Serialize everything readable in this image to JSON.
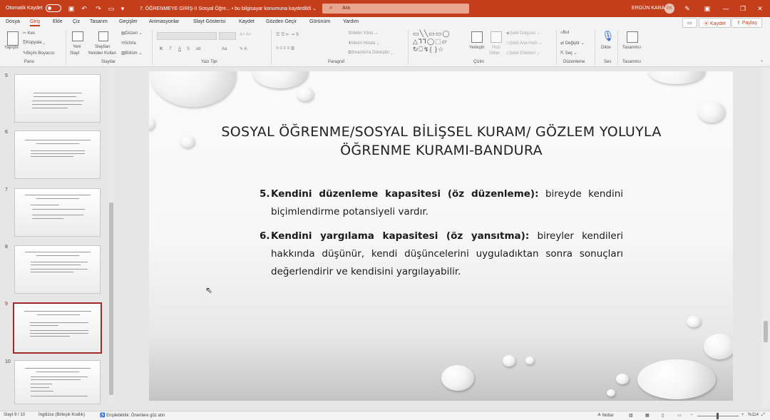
{
  "titlebar": {
    "autosave_label": "Otomatik Kaydet",
    "document_title": "7. ÖĞRENMEYE GİRİŞ-II Sosyal Öğre... • bu bilgisayar konumuna kaydedildi ⌄",
    "search_placeholder": "Ara",
    "user_name": "ERGÜN KARA",
    "user_initials": "EK"
  },
  "tabs": [
    "Dosya",
    "Giriş",
    "Ekle",
    "Çiz",
    "Tasarım",
    "Geçişler",
    "Animasyonlar",
    "Slayt Gösterisi",
    "Kaydet",
    "Gözden Geçir",
    "Görünüm",
    "Yardım"
  ],
  "tab_actions": {
    "record_label": "Kaydet",
    "share_label": "Paylaş"
  },
  "ribbon": {
    "clipboard": {
      "paste": "Yapıştır",
      "cut": "Kes",
      "copy": "Kopyala",
      "format_painter": "Biçim Boyacısı",
      "group": "Pano"
    },
    "slides": {
      "new_slide_line1": "Yeni",
      "new_slide_line2": "Slayt",
      "reuse_line1": "Slaytları",
      "reuse_line2": "Yeniden Kullan",
      "layout": "Düzen",
      "reset": "Sıfırla",
      "section": "Bölüm",
      "group": "Slaytlar"
    },
    "font": {
      "bold": "K",
      "italic": "T",
      "underline": "A",
      "strike": "S",
      "spacing": "ab",
      "case": "Aa",
      "group": "Yazı Tipi"
    },
    "paragraph": {
      "text_direction": "Metin Yönü",
      "align_text": "Metni Hizala",
      "smartart": "SmartArt'a Dönüştür",
      "group": "Paragraf"
    },
    "drawing": {
      "arrange": "Yerleştir",
      "quick_styles_line1": "Hızlı",
      "quick_styles_line2": "Stiller",
      "fill": "Şekil Dolgusu",
      "outline": "Şekil Ana Hattı",
      "effects": "Şekil Efektleri",
      "group": "Çizim"
    },
    "editing": {
      "find": "Bul",
      "replace": "Değiştir",
      "select": "Seç",
      "group": "Düzenleme"
    },
    "voice": {
      "dictate": "Dikte",
      "group": "Ses"
    },
    "designer": {
      "label": "Tasarımcı",
      "group": "Tasarımcı"
    }
  },
  "thumbnails": [
    {
      "number": "5",
      "selected": false
    },
    {
      "number": "6",
      "selected": false
    },
    {
      "number": "7",
      "selected": false
    },
    {
      "number": "8",
      "selected": false
    },
    {
      "number": "9",
      "selected": true
    },
    {
      "number": "10",
      "selected": false
    }
  ],
  "slide": {
    "title_line1": "SOSYAL ÖĞRENME/SOSYAL BİLİŞSEL KURAM/ GÖZLEM YOLUYLA",
    "title_line2": "ÖĞRENME KURAMI-BANDURA",
    "items": [
      {
        "number": "5.",
        "bold": "Kendini düzenleme kapasitesi (öz düzenleme):",
        "rest": " bireyde kendini biçimlendirme potansiyeli vardır."
      },
      {
        "number": "6.",
        "bold": "Kendini yargılama kapasitesi (öz yansıtma):",
        "rest": " bireyler kendileri hakkında düşünür, kendi düşüncelerini uyguladıktan sonra sonuçları değerlendirir ve kendisini yargılayabilir."
      }
    ]
  },
  "statusbar": {
    "slide_info": "Slayt 9 / 10",
    "language": "İngilizce (Birleşik Krallık)",
    "accessibility": "Erişilebilirlik: Önerilere göz atın",
    "notes": "Notlar",
    "zoom": "%114"
  }
}
